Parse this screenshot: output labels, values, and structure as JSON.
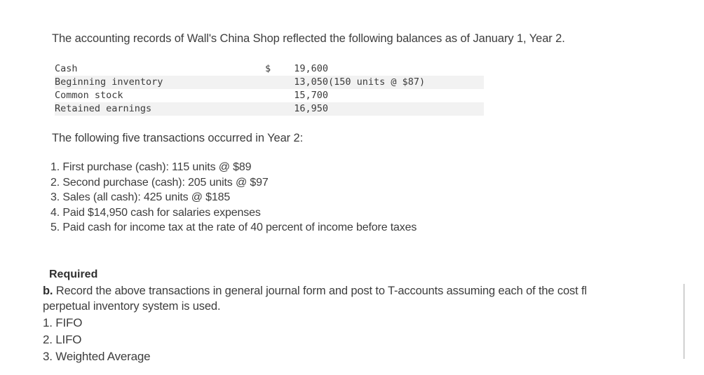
{
  "document": {
    "intro": "The accounting records of Wall's China Shop reflected the following balances as of January 1, Year 2.",
    "lead": "The following five transactions occurred in Year 2:"
  },
  "balances": {
    "rows": [
      {
        "label": "Cash",
        "currency": "$",
        "amount": "19,600",
        "note": "",
        "shaded": false
      },
      {
        "label": "Beginning inventory",
        "currency": "",
        "amount": "13,050",
        "note": "(150 units @ $87)",
        "shaded": true
      },
      {
        "label": "Common stock",
        "currency": "",
        "amount": "15,700",
        "note": "",
        "shaded": false
      },
      {
        "label": "Retained earnings",
        "currency": "",
        "amount": "16,950",
        "note": "",
        "shaded": true
      }
    ]
  },
  "transactions": {
    "items": [
      "1. First purchase (cash): 115 units @ $89",
      "2. Second purchase (cash): 205 units @ $97",
      "3. Sales (all cash): 425 units @ $185",
      "4. Paid $14,950 cash for salaries expenses",
      "5. Paid cash for income tax at the rate of 40 percent of income before taxes"
    ]
  },
  "required": {
    "heading": "Required",
    "item_label": "b.",
    "item_text": " Record the above transactions in general journal form and post to T-accounts assuming each of the cost fl",
    "item_line2": "perpetual inventory system is used.",
    "methods": [
      "1. FIFO",
      "2. LIFO",
      "3. Weighted Average"
    ]
  },
  "style": {
    "background": "#ffffff",
    "text_color": "#3d3d3d",
    "shade_color": "#f2f2f2"
  }
}
